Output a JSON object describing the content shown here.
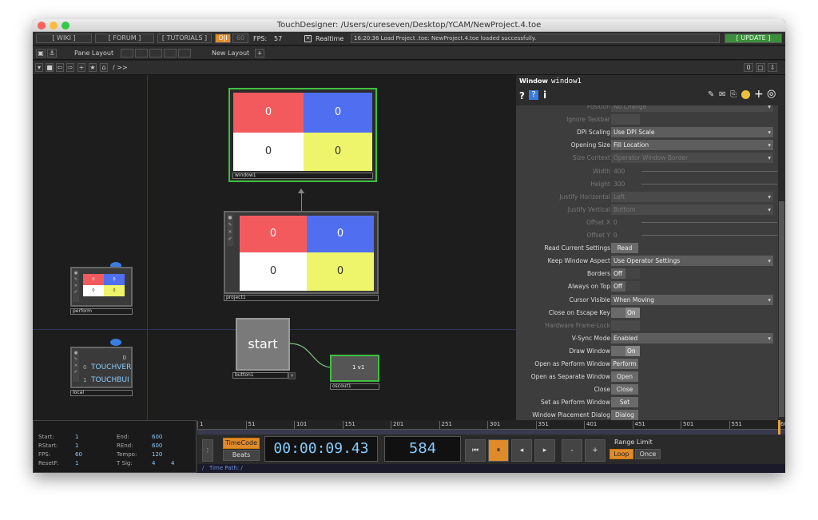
{
  "window_title": "TouchDesigner: /Users/cureseven/Desktop/YCAM/NewProject.4.toe",
  "toolbar": {
    "wiki": "[ WIKI ]",
    "forum": "[ FORUM ]",
    "tutorials": "[ TUTORIALS ]",
    "oi": "O|I",
    "fps_target": "60",
    "fps_label": "FPS:",
    "fps_value": "57",
    "realtime_label": "Realtime",
    "log": "16:20:36 Load Project .toe: NewProject.4.toe loaded successfully.",
    "update": "[ UPDATE ]"
  },
  "panebar": {
    "pane_layout": "Pane Layout",
    "new_layout": "New Layout",
    "plus": "+"
  },
  "pathbar": {
    "path": "/ >>",
    "zero": "0"
  },
  "nodes": {
    "window1": {
      "label": "window1",
      "cells": [
        "0",
        "0",
        "0",
        "0"
      ]
    },
    "project1": {
      "label": "project1",
      "cells": [
        "0",
        "0",
        "0",
        "0"
      ]
    },
    "perform": {
      "label": "perform",
      "cells": [
        "0",
        "0",
        "0",
        "0"
      ]
    },
    "local": {
      "label": "local",
      "value": "0",
      "row0_idx": "0",
      "row0": "TOUCHVER",
      "row1_idx": "1",
      "row1": "TOUCHBUI"
    },
    "button1": {
      "label": "button1",
      "text": "start"
    },
    "oscout1": {
      "label": "oscout1",
      "text": "1 v1"
    }
  },
  "params": {
    "op_type": "Window",
    "op_name": "window1",
    "rows": [
      {
        "label": "Position",
        "value": "No Change",
        "dim": true
      },
      {
        "label": "Ignore Taskbar",
        "value": "",
        "dim": true
      },
      {
        "label": "DPI Scaling",
        "value": "Use DPI Scale",
        "dim": false
      },
      {
        "label": "Opening Size",
        "value": "Fill Location",
        "dim": false
      },
      {
        "label": "Size Context",
        "value": "Operator Window Border",
        "dim": true
      },
      {
        "label": "Width",
        "value": "400",
        "dim": true
      },
      {
        "label": "Height",
        "value": "300",
        "dim": true
      },
      {
        "label": "Justify Horizontal",
        "value": "Left",
        "dim": true
      },
      {
        "label": "Justify Vertical",
        "value": "Bottom",
        "dim": true
      },
      {
        "label": "Offset X",
        "value": "0",
        "dim": true
      },
      {
        "label": "Offset Y",
        "value": "0",
        "dim": true
      },
      {
        "label": "Read Current Settings",
        "value": "Read",
        "dim": false
      },
      {
        "label": "Keep Window Aspect",
        "value": "Use Operator Settings",
        "dim": false
      },
      {
        "label": "Borders",
        "value": "Off",
        "dim": false
      },
      {
        "label": "Always on Top",
        "value": "Off",
        "dim": false
      },
      {
        "label": "Cursor Visible",
        "value": "When Moving",
        "dim": false
      },
      {
        "label": "Close on Escape Key",
        "value": "On",
        "dim": false
      },
      {
        "label": "Hardware Frame-Lock",
        "value": "",
        "dim": true
      },
      {
        "label": "V-Sync Mode",
        "value": "Enabled",
        "dim": false
      },
      {
        "label": "Draw Window",
        "value": "On",
        "dim": false
      },
      {
        "label": "Open as Perform Window",
        "value": "Perform",
        "dim": false
      },
      {
        "label": "Open as Separate Window",
        "value": "Open",
        "dim": false
      },
      {
        "label": "Close",
        "value": "Close",
        "dim": false
      },
      {
        "label": "Set as Perform Window",
        "value": "Set",
        "dim": false
      },
      {
        "label": "Window Placement Dialog",
        "value": "Dialog",
        "dim": false
      }
    ]
  },
  "timeline": {
    "ticks": [
      "1",
      "51",
      "101",
      "151",
      "201",
      "251",
      "301",
      "351",
      "401",
      "451",
      "501",
      "551",
      "600"
    ],
    "stats": {
      "start_l": "Start:",
      "start": "1",
      "end_l": "End:",
      "end": "600",
      "rstart_l": "RStart:",
      "rstart": "1",
      "rend_l": "REnd:",
      "rend": "600",
      "fps_l": "FPS:",
      "fps": "60",
      "tempo_l": "Tempo:",
      "tempo": "120",
      "resetf_l": "ResetF:",
      "resetf": "1",
      "tsig_l": "T Sig:",
      "tsig_a": "4",
      "tsig_b": "4"
    },
    "timecode": "TimeCode",
    "beats": "Beats",
    "time": "00:00:09.43",
    "frame": "584",
    "range_limit": "Range Limit",
    "loop": "Loop",
    "once": "Once",
    "time_path": "Time Path: /"
  },
  "colors": {
    "red": "#f35a5e",
    "blue": "#4f6ef0",
    "white": "#ffffff",
    "yellow": "#eef56a",
    "accent": "#e08b2a",
    "green": "#3a9a3a"
  }
}
